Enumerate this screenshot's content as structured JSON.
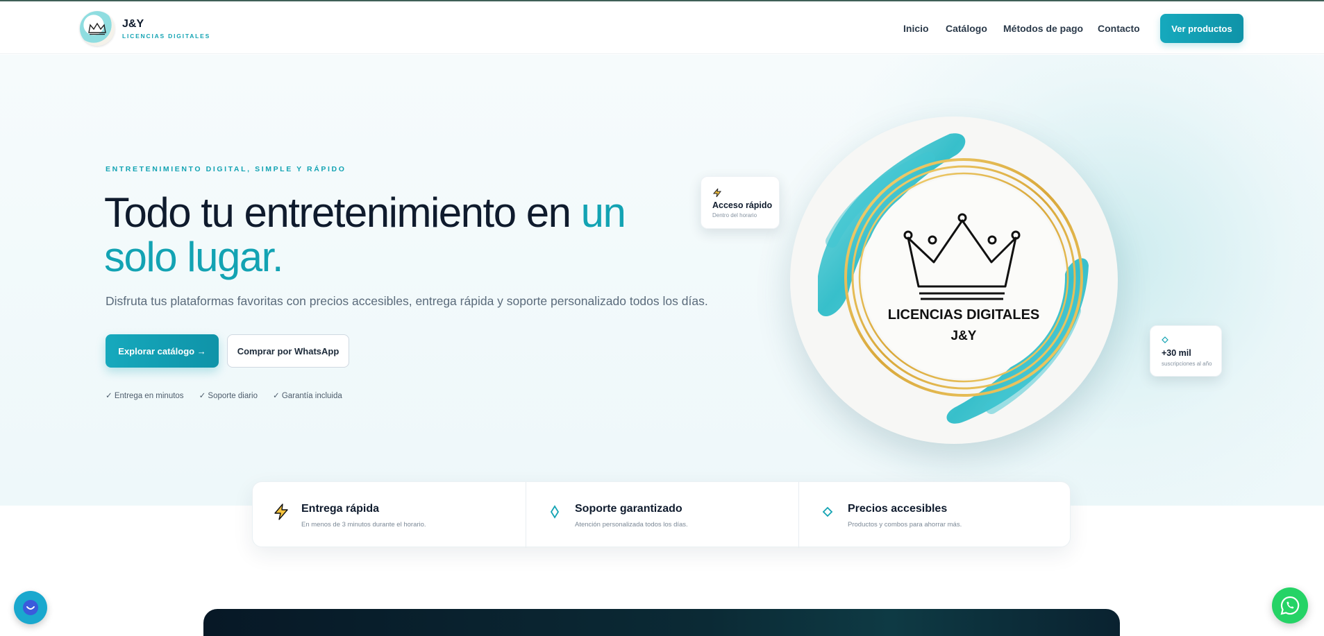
{
  "brand": {
    "name": "J&Y",
    "subtitle": "LICENCIAS DIGITALES"
  },
  "nav": {
    "items": [
      {
        "label": "Inicio"
      },
      {
        "label": "Catálogo"
      },
      {
        "label": "Métodos de pago"
      },
      {
        "label": "Contacto"
      }
    ],
    "cta_label": "Ver productos"
  },
  "hero": {
    "eyebrow": "ENTRETENIMIENTO DIGITAL, SIMPLE Y RÁPIDO",
    "headline_main": "Todo tu entretenimiento en ",
    "headline_accent_1": "un",
    "headline_accent_2": "solo lugar.",
    "subtext": "Disfruta tus plataformas favoritas con precios accesibles, entrega rápida y soporte personalizado todos los días.",
    "primary_button": "Explorar catálogo →",
    "secondary_button": "Comprar por WhatsApp",
    "checks": [
      "✓ Entrega en minutos",
      "✓ Soporte diario",
      "✓ Garantía incluida"
    ]
  },
  "logo_badge": {
    "line1": "LICENCIAS DIGITALES",
    "line2": "J&Y"
  },
  "floating_cards": {
    "fast": {
      "icon": "lightning-icon",
      "title": "Acceso rápido",
      "subtitle": "Dentro del horario"
    },
    "subs": {
      "icon": "diamond-icon",
      "title": "+30 mil",
      "subtitle": "suscripciones al año"
    }
  },
  "features": [
    {
      "icon": "lightning-icon",
      "title": "Entrega rápida",
      "desc": "En menos de 3 minutos durante el horario."
    },
    {
      "icon": "diamond-icon",
      "title": "Soporte garantizado",
      "desc": "Atención personalizada todos los días."
    },
    {
      "icon": "diamond-icon",
      "title": "Precios accesibles",
      "desc": "Productos y combos para ahorrar más."
    }
  ],
  "colors": {
    "accent": "#13a3b3",
    "text_dark": "#0f1b2d",
    "whatsapp": "#25d366",
    "gold": "#e2b64a"
  }
}
